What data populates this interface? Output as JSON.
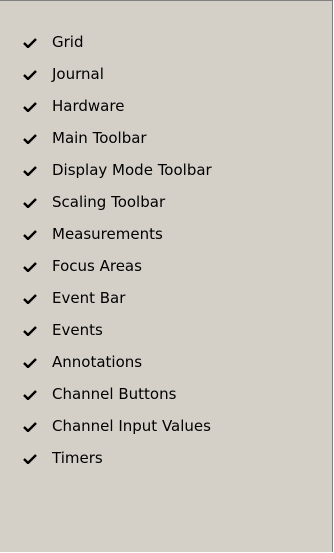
{
  "menu": {
    "items": [
      {
        "label": "Grid",
        "checked": true,
        "icon": "checkmark-icon"
      },
      {
        "label": "Journal",
        "checked": true,
        "icon": "checkmark-icon"
      },
      {
        "label": "Hardware",
        "checked": true,
        "icon": "checkmark-icon"
      },
      {
        "label": "Main Toolbar",
        "checked": true,
        "icon": "checkmark-icon"
      },
      {
        "label": "Display Mode Toolbar",
        "checked": true,
        "icon": "checkmark-icon"
      },
      {
        "label": "Scaling Toolbar",
        "checked": true,
        "icon": "checkmark-icon"
      },
      {
        "label": "Measurements",
        "checked": true,
        "icon": "checkmark-icon"
      },
      {
        "label": "Focus Areas",
        "checked": true,
        "icon": "checkmark-icon"
      },
      {
        "label": "Event Bar",
        "checked": true,
        "icon": "checkmark-icon"
      },
      {
        "label": "Events",
        "checked": true,
        "icon": "checkmark-icon"
      },
      {
        "label": "Annotations",
        "checked": true,
        "icon": "checkmark-icon"
      },
      {
        "label": "Channel Buttons",
        "checked": true,
        "icon": "checkmark-icon"
      },
      {
        "label": "Channel Input Values",
        "checked": true,
        "icon": "checkmark-icon"
      },
      {
        "label": "Timers",
        "checked": true,
        "icon": "checkmark-icon"
      }
    ]
  },
  "colors": {
    "menu_background": "#d4d0c8",
    "menu_border": "#808080",
    "text": "#000000"
  }
}
